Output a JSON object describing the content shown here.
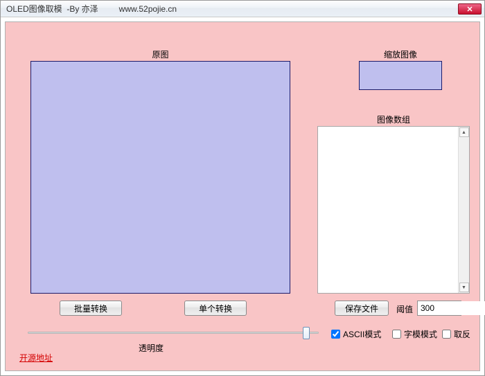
{
  "window": {
    "title": "OLED图像取模  -By 亦泽         www.52pojie.cn"
  },
  "labels": {
    "original": "原图",
    "scaled": "缩放图像",
    "array": "图像数组",
    "opacity": "透明度",
    "threshold": "阈值"
  },
  "buttons": {
    "batch": "批量转换",
    "single": "单个转换",
    "save": "保存文件"
  },
  "inputs": {
    "threshold_value": "300",
    "array_text": ""
  },
  "checkboxes": {
    "ascii": {
      "label": "ASCII模式",
      "checked": true
    },
    "font": {
      "label": "字模模式",
      "checked": false
    },
    "invert": {
      "label": "取反",
      "checked": false
    }
  },
  "link": {
    "open_source": "开源地址"
  }
}
